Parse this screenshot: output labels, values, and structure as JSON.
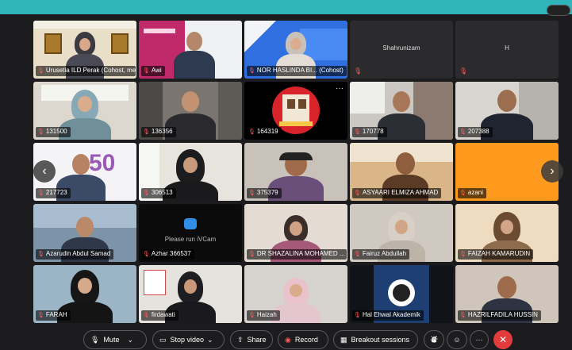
{
  "participants": [
    {
      "name": "Urusetia ILD Perak (Cohost, me)",
      "muted": true
    },
    {
      "name": "Awi",
      "muted": true
    },
    {
      "name": "NOR HASLINDA BI... (Cohost)",
      "muted": true
    },
    {
      "name": "Shahrunizam",
      "muted": true
    },
    {
      "name": "H",
      "muted": true
    },
    {
      "name": "131500",
      "muted": true
    },
    {
      "name": "136356",
      "muted": true
    },
    {
      "name": "164319",
      "muted": true
    },
    {
      "name": "170778",
      "muted": true
    },
    {
      "name": "207388",
      "muted": true
    },
    {
      "name": "217723",
      "muted": true
    },
    {
      "name": "306513",
      "muted": true
    },
    {
      "name": "375379",
      "muted": true
    },
    {
      "name": "ASYAARI ELMIZA AHMAD",
      "muted": true
    },
    {
      "name": "azani",
      "muted": true
    },
    {
      "name": "Azarudin Abdul Samad",
      "muted": true
    },
    {
      "name": "Azhar 366537",
      "muted": true
    },
    {
      "name": "DR SHAZALINA MOHAMED ...",
      "muted": true
    },
    {
      "name": "Fairuz Abdullah",
      "muted": true
    },
    {
      "name": "FAIZAH KAMARUDIN",
      "muted": true
    },
    {
      "name": "FARAH",
      "muted": true
    },
    {
      "name": "firdawati",
      "muted": true
    },
    {
      "name": "Haizah",
      "muted": true
    },
    {
      "name": "Hal Ehwal Akademik",
      "muted": true
    },
    {
      "name": "HAZRILFADILA HUSSIN",
      "muted": true
    }
  ],
  "ivcam_text": "Please run iVCam",
  "toolbar": {
    "mute": "Mute",
    "stop_video": "Stop video",
    "share": "Share",
    "record": "Record",
    "breakout": "Breakout sessions"
  },
  "colors": {
    "topbar": "#2fb4ba",
    "leave": "#e23c3c",
    "orange_tile": "#ff9a1f"
  }
}
